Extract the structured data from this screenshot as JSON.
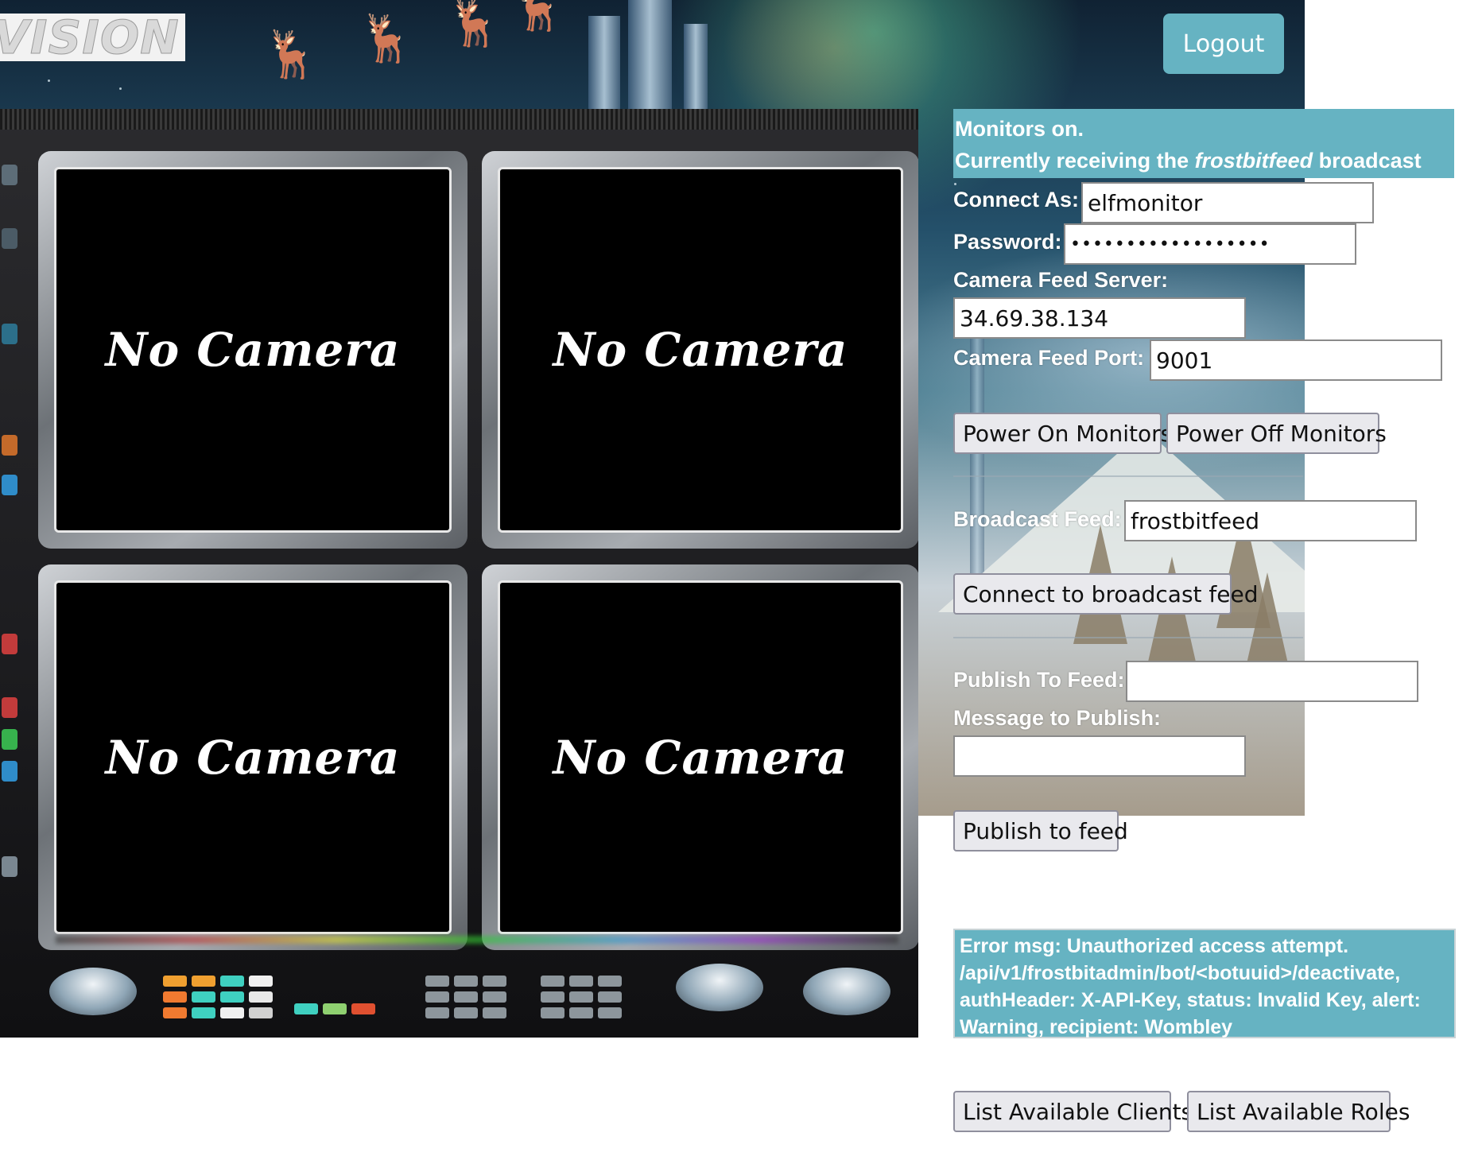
{
  "logo": {
    "text": "VISION"
  },
  "header": {
    "logout_label": "Logout"
  },
  "monitors": {
    "screens": [
      "No Camera",
      "No Camera",
      "No Camera",
      "No Camera"
    ]
  },
  "status": {
    "line1": "Monitors on.",
    "line2_prefix": "Currently receiving the ",
    "line2_feed": "frostbitfeed",
    "line2_suffix": " broadcast"
  },
  "connection": {
    "connect_as_label": "Connect As:",
    "connect_as_value": "elfmonitor",
    "password_label": "Password:",
    "password_value": "••••••••••••••••••",
    "server_label": "Camera Feed Server:",
    "server_value": "34.69.38.134",
    "port_label": "Camera Feed Port:",
    "port_value": "9001"
  },
  "power": {
    "on_label": "Power On Monitors",
    "off_label": "Power Off Monitors"
  },
  "broadcast": {
    "feed_label": "Broadcast Feed:",
    "feed_value": "frostbitfeed",
    "connect_label": "Connect to broadcast feed"
  },
  "publish": {
    "feed_label": "Publish To Feed:",
    "feed_value": "",
    "message_label": "Message to Publish:",
    "message_value": "",
    "button_label": "Publish to feed"
  },
  "error": {
    "message": "Error msg: Unauthorized access attempt. /api/v1/frostbitadmin/bot/<botuuid>/deactivate, authHeader: X-API-Key, status: Invalid Key, alert: Warning, recipient: Wombley"
  },
  "footer": {
    "list_clients_label": "List Available Clients",
    "list_roles_label": "List Available Roles"
  },
  "colors": {
    "accent": "#66b3c2",
    "screen": "#000000"
  }
}
